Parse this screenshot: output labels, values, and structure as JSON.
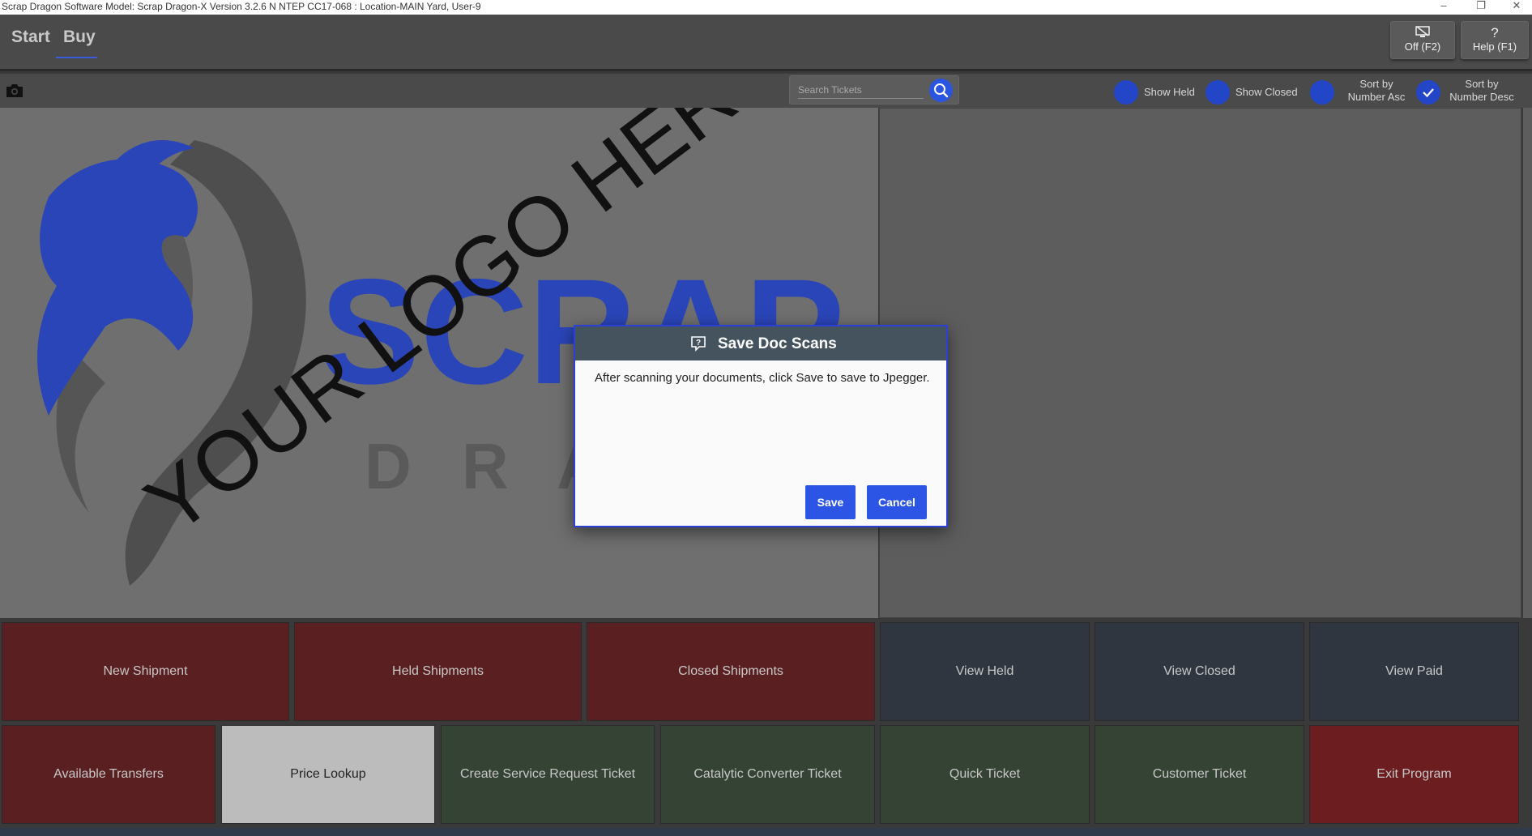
{
  "window": {
    "title": "Scrap Dragon Software Model: Scrap Dragon-X Version 3.2.6 N NTEP CC17-068 : Location-MAIN Yard, User-9",
    "minimize": "–",
    "restore": "❐",
    "close": "✕"
  },
  "nav": {
    "tabs": [
      "Start",
      "Buy"
    ],
    "active_tab": "Buy",
    "off_button": "Off (F2)",
    "help_button": "Help (F1)",
    "help_icon": "?"
  },
  "toolbar": {
    "search_placeholder": "Search Tickets",
    "show_held": "Show Held",
    "show_closed": "Show Closed",
    "sort_asc_line1": "Sort by",
    "sort_asc_line2": "Number Asc",
    "sort_desc_line1": "Sort by",
    "sort_desc_line2": "Number Desc"
  },
  "logo": {
    "brand_top": "SCRAP",
    "brand_bottom": "D R A",
    "watermark": "YOUR LOGO HERE",
    "brand_color": "#2a45b8"
  },
  "tiles": {
    "row1": [
      "New Shipment",
      "Held Shipments",
      "Closed Shipments",
      "View Held",
      "View Closed",
      "View Paid"
    ],
    "row2": [
      "Available Transfers",
      "Price Lookup",
      "Create Service Request Ticket",
      "Catalytic Converter Ticket",
      "Quick Ticket",
      "Customer Ticket",
      "Exit Program"
    ]
  },
  "dialog": {
    "title": "Save Doc Scans",
    "message": "After scanning your documents, click Save to save to Jpegger.",
    "save": "Save",
    "cancel": "Cancel"
  },
  "colors": {
    "accent": "#2c55e6",
    "tile_red": "#5a1f21",
    "tile_slate": "#2f3640",
    "tile_green": "#344333"
  }
}
